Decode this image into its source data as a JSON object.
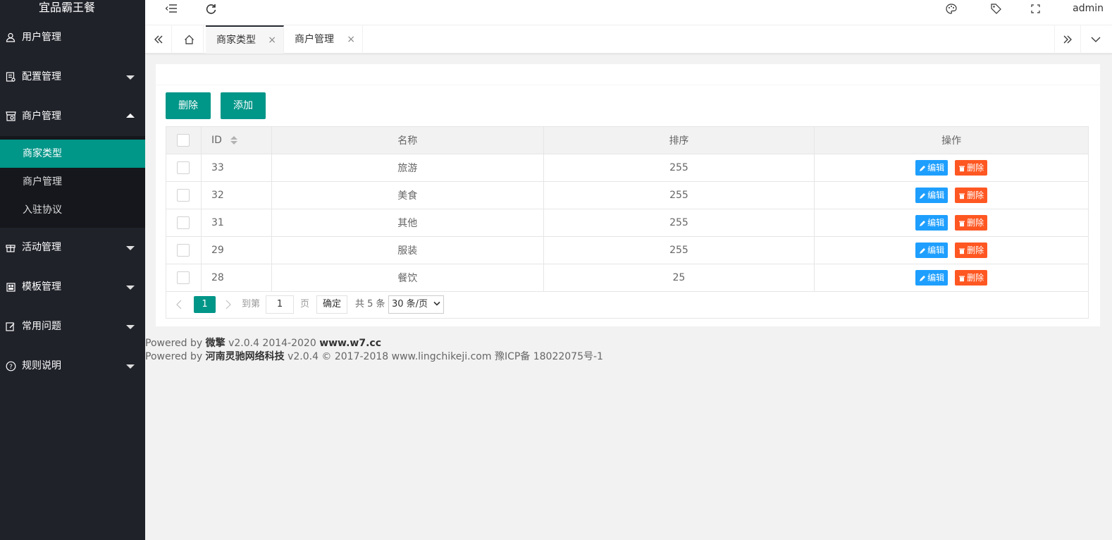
{
  "app_title": "宜品霸王餐",
  "header": {
    "user": "admin"
  },
  "sidebar": {
    "items": [
      {
        "label": "用户管理"
      },
      {
        "label": "配置管理"
      },
      {
        "label": "商户管理",
        "children": [
          {
            "label": "商家类型"
          },
          {
            "label": "商户管理"
          },
          {
            "label": "入驻协议"
          }
        ]
      },
      {
        "label": "活动管理"
      },
      {
        "label": "模板管理"
      },
      {
        "label": "常用问题"
      },
      {
        "label": "规则说明"
      }
    ]
  },
  "tabs": [
    {
      "label": "商家类型"
    },
    {
      "label": "商户管理"
    }
  ],
  "toolbar": {
    "delete_label": "删除",
    "add_label": "添加"
  },
  "table": {
    "headers": {
      "id": "ID",
      "name": "名称",
      "sort": "排序",
      "ops": "操作"
    },
    "rows": [
      {
        "id": "33",
        "name": "旅游",
        "sort": "255"
      },
      {
        "id": "32",
        "name": "美食",
        "sort": "255"
      },
      {
        "id": "31",
        "name": "其他",
        "sort": "255"
      },
      {
        "id": "29",
        "name": "服装",
        "sort": "255"
      },
      {
        "id": "28",
        "name": "餐饮",
        "sort": "25"
      }
    ],
    "edit_label": "编辑",
    "delete_label": "删除"
  },
  "pager": {
    "current": "1",
    "goto_label": "到第",
    "page_input": "1",
    "page_unit": "页",
    "confirm": "确定",
    "total": "共 5 条",
    "per_page": "30 条/页"
  },
  "footer": {
    "line1_prefix": "Powered by",
    "line1_brand": "微擎",
    "line1_version": "v2.0.4 2014-2020",
    "line1_site": "www.w7.cc",
    "line2_prefix": "Powered by",
    "line2_brand": "河南灵驰网络科技",
    "line2_rest": "v2.0.4 © 2017-2018 www.lingchikeji.com 豫ICP备 18022075号-1"
  },
  "colors": {
    "sidebar_bg": "#20222a",
    "accent": "#009688",
    "edit": "#1e9fff",
    "delete": "#ff5722"
  }
}
